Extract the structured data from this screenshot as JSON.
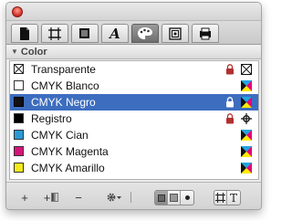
{
  "section": {
    "title": "Color",
    "expanded": true
  },
  "tabs": [
    {
      "name": "document"
    },
    {
      "name": "crop"
    },
    {
      "name": "frame"
    },
    {
      "name": "text"
    },
    {
      "name": "color",
      "active": true
    },
    {
      "name": "image"
    },
    {
      "name": "print"
    }
  ],
  "swatches": [
    {
      "label": "Transparente",
      "swatch_color": "none",
      "locked": true,
      "type_icon": "none-type-icon"
    },
    {
      "label": "CMYK Blanco",
      "swatch_color": "#ffffff",
      "locked": false,
      "type_icon": "cmyk-type-icon"
    },
    {
      "label": "CMYK Negro",
      "swatch_color": "#111111",
      "locked": true,
      "type_icon": "cmyk-type-icon",
      "selected": true
    },
    {
      "label": "Registro",
      "swatch_color": "#000000",
      "locked": true,
      "type_icon": "registration-type-icon"
    },
    {
      "label": "CMYK Cian",
      "swatch_color": "#2a9ad6",
      "locked": false,
      "type_icon": "cmyk-type-icon"
    },
    {
      "label": "CMYK Magenta",
      "swatch_color": "#d6157a",
      "locked": false,
      "type_icon": "cmyk-type-icon"
    },
    {
      "label": "CMYK Amarillo",
      "swatch_color": "#f4ea18",
      "locked": false,
      "type_icon": "cmyk-type-icon"
    }
  ],
  "footer": {
    "add_label": "+",
    "add_gradient_label": "+",
    "remove_label": "−",
    "view_mode_selected": "small-swatch",
    "apply_mode_selected": "stroke"
  },
  "colors": {
    "selection": "#3d6dbf",
    "panel": "#ececec"
  }
}
